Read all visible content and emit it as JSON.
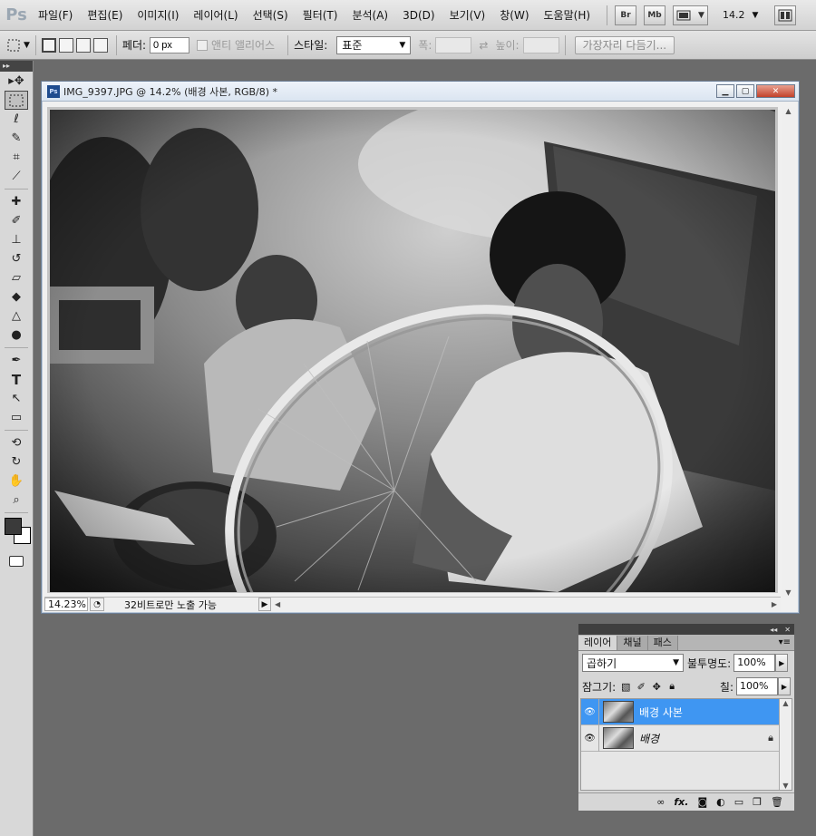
{
  "app": {
    "logo": "Ps"
  },
  "menu": [
    "파일(F)",
    "편집(E)",
    "이미지(I)",
    "레이어(L)",
    "선택(S)",
    "필터(T)",
    "분석(A)",
    "3D(D)",
    "보기(V)",
    "창(W)",
    "도움말(H)"
  ],
  "menubar_right": {
    "bridge": "Br",
    "mini_bridge": "Mb",
    "zoom": "14.2"
  },
  "options": {
    "feather_label": "페더:",
    "feather_value": "0 px",
    "antialias_label": "앤티 앨리어스",
    "style_label": "스타일:",
    "style_value": "표준",
    "width_label": "폭:",
    "height_label": "높이:",
    "refine_edge_label": "가장자리 다듬기..."
  },
  "document": {
    "title": "IMG_9397.JPG @ 14.2% (배경 사본, RGB/8) *",
    "zoom_status": "14.23%",
    "status_text": "32비트로만 노출 가능"
  },
  "layers_panel": {
    "tabs": [
      "레이어",
      "채널",
      "패스"
    ],
    "active_tab": "레이어",
    "blend_mode": "곱하기",
    "opacity_label": "불투명도:",
    "opacity_value": "100%",
    "lock_label": "잠그기:",
    "fill_label": "칠:",
    "fill_value": "100%",
    "layers": [
      {
        "name": "배경 사본",
        "selected": true
      },
      {
        "name": "배경",
        "selected": false
      }
    ]
  },
  "colors": {
    "app_bg": "#6b6b6b",
    "selected_layer": "#3f96f2",
    "foreground": "#3a3a3a",
    "background": "#ffffff"
  },
  "icons": {
    "tools": [
      "move-tool",
      "marquee-tool",
      "lasso-tool",
      "quick-selection-tool",
      "crop-tool",
      "eyedropper-tool",
      "healing-brush-tool",
      "brush-tool",
      "clone-stamp-tool",
      "history-brush-tool",
      "eraser-tool",
      "paint-bucket-tool",
      "blur-tool",
      "dodge-tool",
      "pen-tool",
      "type-tool",
      "path-selection-tool",
      "shape-tool",
      "3d-rotate-tool",
      "3d-orbit-tool",
      "hand-tool",
      "zoom-tool"
    ]
  }
}
